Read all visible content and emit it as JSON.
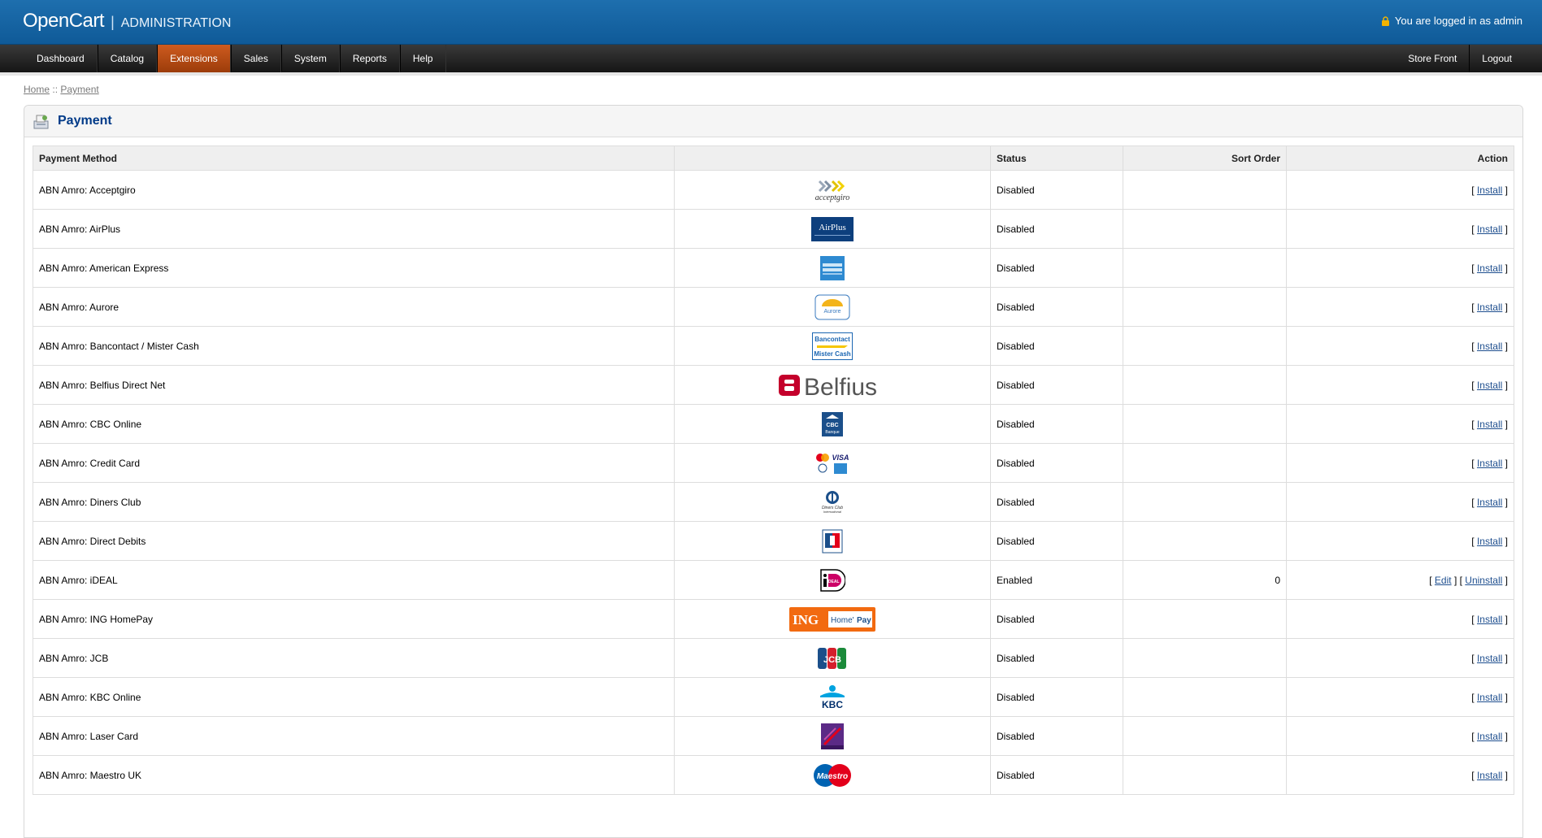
{
  "header": {
    "brand": "OpenCart",
    "separator": "|",
    "subtitle": "ADMINISTRATION",
    "logged_in": "You are logged in as admin"
  },
  "menu": {
    "left": [
      "Dashboard",
      "Catalog",
      "Extensions",
      "Sales",
      "System",
      "Reports",
      "Help"
    ],
    "active": "Extensions",
    "right": [
      "Store Front",
      "Logout"
    ]
  },
  "breadcrumb": {
    "home": "Home",
    "separator": "::",
    "current": "Payment"
  },
  "page": {
    "title": "Payment"
  },
  "table": {
    "columns": [
      "Payment Method",
      "",
      "Status",
      "Sort Order",
      "Action"
    ],
    "rows": [
      {
        "method": "ABN Amro: Acceptgiro",
        "logo": "acceptgiro",
        "status": "Disabled",
        "sort": "",
        "actions": [
          "Install"
        ]
      },
      {
        "method": "ABN Amro: AirPlus",
        "logo": "airplus",
        "status": "Disabled",
        "sort": "",
        "actions": [
          "Install"
        ]
      },
      {
        "method": "ABN Amro: American Express",
        "logo": "amex",
        "status": "Disabled",
        "sort": "",
        "actions": [
          "Install"
        ]
      },
      {
        "method": "ABN Amro: Aurore",
        "logo": "aurore",
        "status": "Disabled",
        "sort": "",
        "actions": [
          "Install"
        ]
      },
      {
        "method": "ABN Amro: Bancontact / Mister Cash",
        "logo": "bancontact",
        "status": "Disabled",
        "sort": "",
        "actions": [
          "Install"
        ]
      },
      {
        "method": "ABN Amro: Belfius Direct Net",
        "logo": "belfius",
        "status": "Disabled",
        "sort": "",
        "actions": [
          "Install"
        ]
      },
      {
        "method": "ABN Amro: CBC Online",
        "logo": "cbc",
        "status": "Disabled",
        "sort": "",
        "actions": [
          "Install"
        ]
      },
      {
        "method": "ABN Amro: Credit Card",
        "logo": "creditcard",
        "status": "Disabled",
        "sort": "",
        "actions": [
          "Install"
        ]
      },
      {
        "method": "ABN Amro: Diners Club",
        "logo": "diners",
        "status": "Disabled",
        "sort": "",
        "actions": [
          "Install"
        ]
      },
      {
        "method": "ABN Amro: Direct Debits",
        "logo": "directdebits",
        "status": "Disabled",
        "sort": "",
        "actions": [
          "Install"
        ]
      },
      {
        "method": "ABN Amro: iDEAL",
        "logo": "ideal",
        "status": "Enabled",
        "sort": "0",
        "actions": [
          "Edit",
          "Uninstall"
        ]
      },
      {
        "method": "ABN Amro: ING HomePay",
        "logo": "ing",
        "status": "Disabled",
        "sort": "",
        "actions": [
          "Install"
        ]
      },
      {
        "method": "ABN Amro: JCB",
        "logo": "jcb",
        "status": "Disabled",
        "sort": "",
        "actions": [
          "Install"
        ]
      },
      {
        "method": "ABN Amro: KBC Online",
        "logo": "kbc",
        "status": "Disabled",
        "sort": "",
        "actions": [
          "Install"
        ]
      },
      {
        "method": "ABN Amro: Laser Card",
        "logo": "laser",
        "status": "Disabled",
        "sort": "",
        "actions": [
          "Install"
        ]
      },
      {
        "method": "ABN Amro: Maestro UK",
        "logo": "maestro",
        "status": "Disabled",
        "sort": "",
        "actions": [
          "Install"
        ]
      }
    ]
  },
  "logo_text": {
    "acceptgiro": "acceptgiro",
    "airplus": "AirPlus",
    "aurore": "Aurore",
    "bancontact": [
      "Bancontact",
      "Mister Cash"
    ],
    "belfius": "Belfius",
    "cbc": [
      "CBC",
      "Banque"
    ],
    "creditcard": "VISA",
    "diners": [
      "Diners Club",
      "International"
    ],
    "ideal": "iDEAL",
    "ing": [
      "ING",
      "Home'",
      "Pay"
    ],
    "jcb": "JCB",
    "kbc": "KBC",
    "maestro": "Maestro"
  },
  "colors": {
    "header_blue": "#1565a6",
    "menu_dark": "#222222",
    "menu_active": "#c0501a",
    "title_blue": "#003a88",
    "link_blue": "#1f4f8f"
  }
}
